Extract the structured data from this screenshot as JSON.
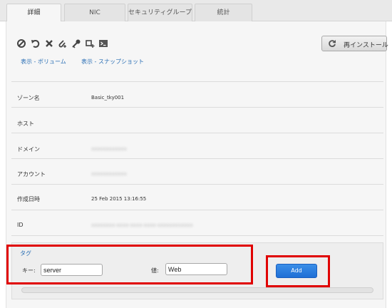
{
  "tabs": [
    {
      "label": "詳細",
      "active": true
    },
    {
      "label": "NIC",
      "active": false
    },
    {
      "label": "セキュリティグループ",
      "active": false
    },
    {
      "label": "統計",
      "active": false
    }
  ],
  "toolbar": {
    "icons": [
      "ban-icon",
      "restart-icon",
      "close-icon",
      "attach-icon",
      "key-icon",
      "add-node-icon",
      "console-icon"
    ]
  },
  "links": {
    "volumes": "表示 - ボリューム",
    "snapshots": "表示 - スナップショット"
  },
  "reinstall_button": "再インストール",
  "details": [
    {
      "label": "ゾーン名",
      "value": "Basic_tky001",
      "masked": false
    },
    {
      "label": "ホスト",
      "value": "",
      "masked": false
    },
    {
      "label": "ドメイン",
      "value": "xxxxxxxxxxxx",
      "masked": true
    },
    {
      "label": "アカウント",
      "value": "xxxxxxxxxxxx",
      "masked": true
    },
    {
      "label": "作成日時",
      "value": "25 Feb 2015 13:16:55",
      "masked": false
    },
    {
      "label": "ID",
      "value": "xxxxxxxx-xxxx-xxxx-xxxx-xxxxxxxxxxxx",
      "masked": true
    }
  ],
  "tag_form": {
    "title": "タグ",
    "key_label": "キー:",
    "key_value": "server",
    "value_label": "値:",
    "value_value": "Web",
    "add_button": "Add"
  },
  "colors": {
    "link": "#2a6fb5",
    "highlight": "#e00000",
    "add_button": "#2176e0"
  }
}
